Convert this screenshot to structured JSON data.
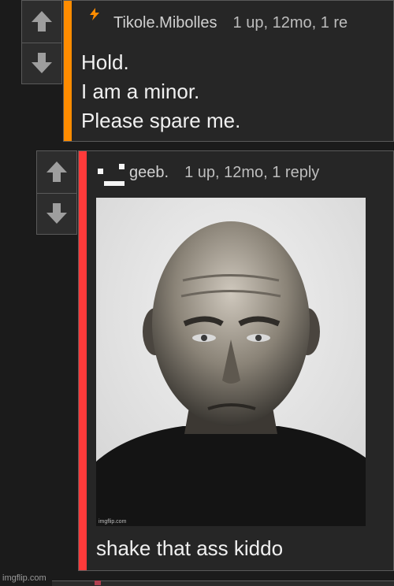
{
  "comments": [
    {
      "username": "Tikole.Mibolles",
      "meta": "1 up, 12mo, 1 re",
      "bar_color": "#ff8c00",
      "badge_icon": "lightning-icon",
      "lines": [
        "Hold.",
        "I am a minor.",
        "Please spare me."
      ]
    },
    {
      "username": "geeb.",
      "meta": "1 up, 12mo, 1 reply",
      "bar_color": "#ff3a3a",
      "badge_icon": "face-icon",
      "image_watermark": "imgflip.com",
      "caption": "shake that ass kiddo"
    }
  ],
  "footer": {
    "watermark": "imgflip.com"
  },
  "icons": {
    "upvote": "arrow-up-icon",
    "downvote": "arrow-down-icon"
  }
}
